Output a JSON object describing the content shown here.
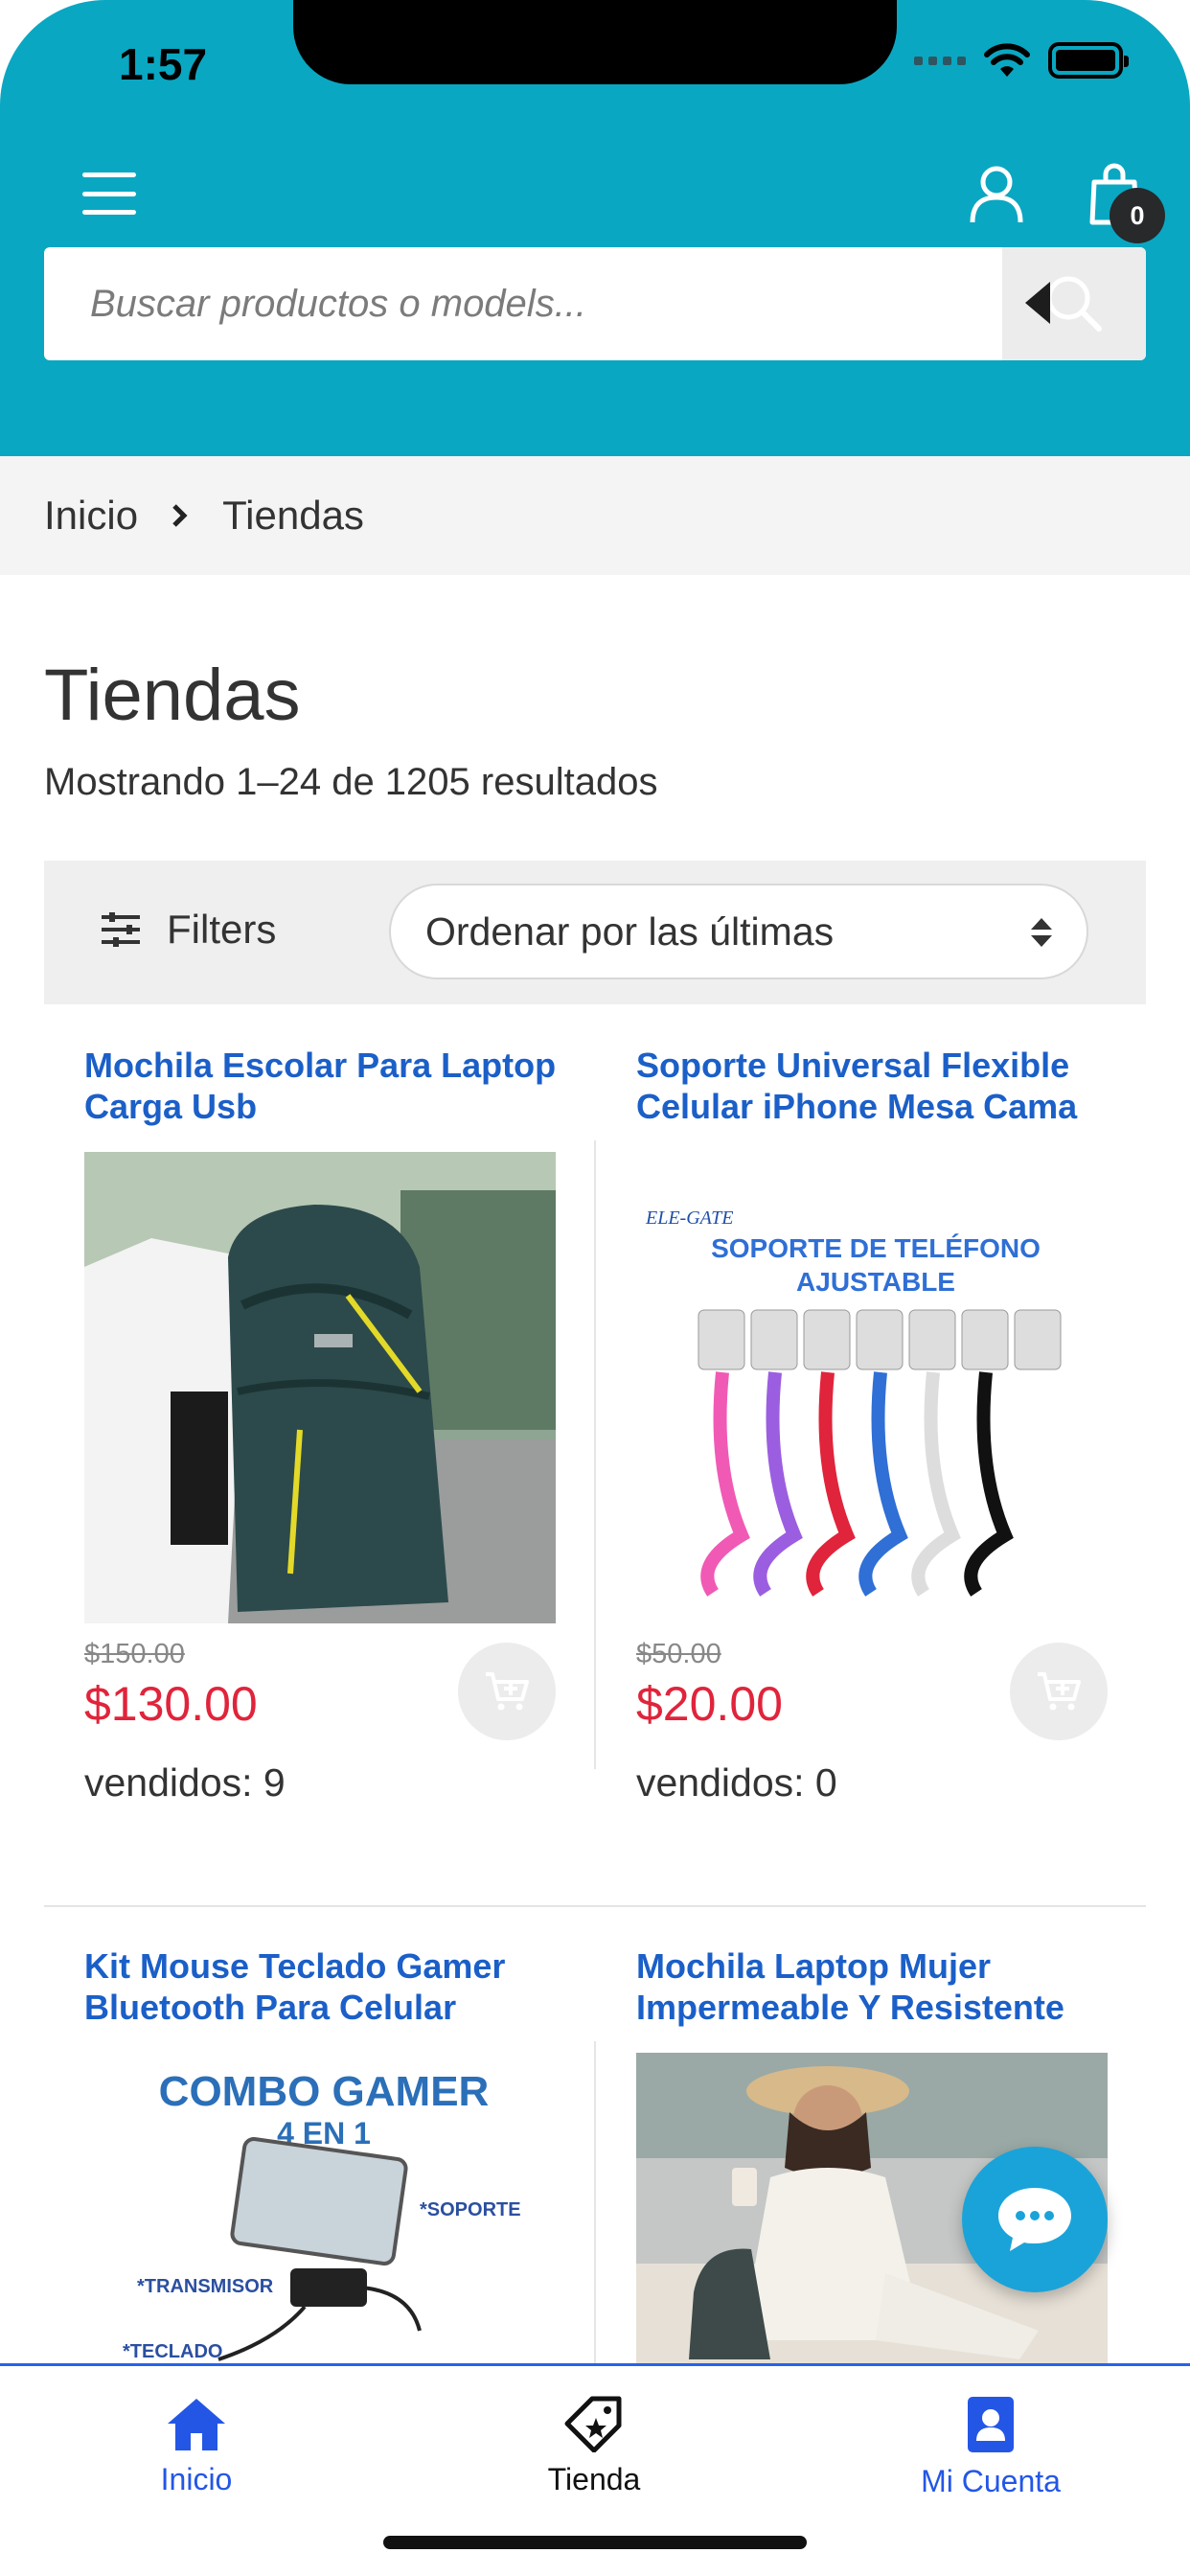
{
  "status_bar": {
    "time": "1:57"
  },
  "header": {
    "cart_count": "0",
    "search": {
      "placeholder": "Buscar productos o models..."
    }
  },
  "colors": {
    "header_bg": "#0aa7c2",
    "title_blue": "#1b5fc8",
    "price_red": "#e0243b",
    "tab_active": "#2456e6"
  },
  "breadcrumb": {
    "home": "Inicio",
    "current": "Tiendas"
  },
  "page": {
    "title": "Tiendas",
    "results": "Mostrando 1–24 de 1205 resultados"
  },
  "toolbar": {
    "filters_label": "Filters",
    "sort_label": "Ordenar por las últimas"
  },
  "products": [
    {
      "title": "Mochila Escolar Para Laptop Carga Usb",
      "old_price": "$150.00",
      "price": "$130.00",
      "sold": "vendidos: 9"
    },
    {
      "title": "Soporte Universal Flexible Celular iPhone Mesa Cama",
      "old_price": "$50.00",
      "price": "$20.00",
      "sold": "vendidos: 0",
      "img_text": {
        "brand": "ELE-GATE",
        "line1": "SOPORTE DE TELÉFONO",
        "line2": "AJUSTABLE"
      }
    },
    {
      "title": "Kit Mouse Teclado Gamer Bluetooth Para Celular",
      "img_text": {
        "line1": "COMBO GAMER",
        "line2": "4 EN 1",
        "label1": "*SOPORTE",
        "label2": "*TRANSMISOR",
        "label3": "*TECLADO"
      }
    },
    {
      "title": "Mochila Laptop Mujer Impermeable Y Resistente"
    }
  ],
  "tabbar": {
    "home": "Inicio",
    "store": "Tienda",
    "account": "Mi Cuenta"
  },
  "icons": [
    "hamburger-icon",
    "user-icon",
    "shopping-bag-icon",
    "search-icon",
    "chevron-right-icon",
    "filter-sliders-icon",
    "sort-arrows-icon",
    "add-to-cart-icon",
    "chat-icon",
    "home-icon",
    "store-tag-icon",
    "account-book-icon"
  ]
}
